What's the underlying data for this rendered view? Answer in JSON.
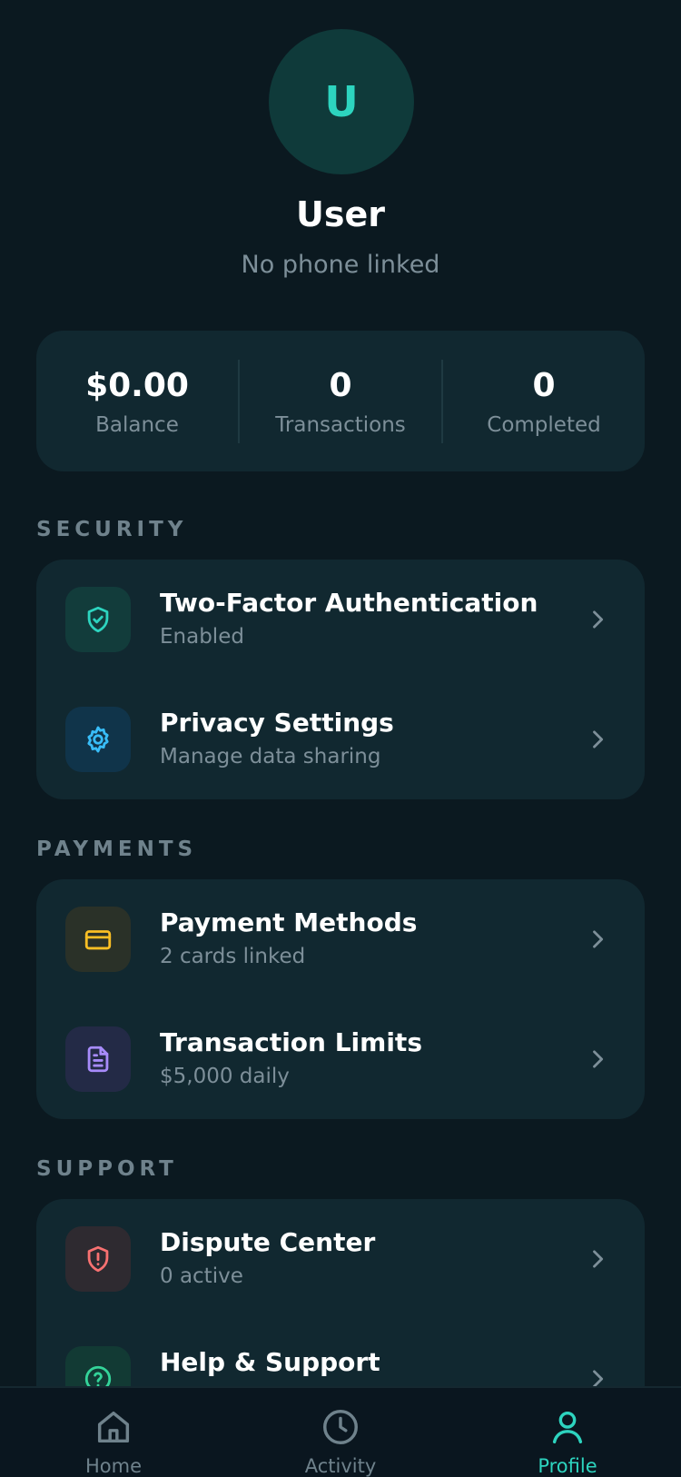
{
  "profile": {
    "avatar_initial": "U",
    "name": "User",
    "phone": "No phone linked"
  },
  "stats": [
    {
      "value": "$0.00",
      "label": "Balance"
    },
    {
      "value": "0",
      "label": "Transactions"
    },
    {
      "value": "0",
      "label": "Completed"
    }
  ],
  "sections": {
    "security": {
      "title": "SECURITY",
      "items": [
        {
          "title": "Two-Factor Authentication",
          "subtitle": "Enabled",
          "icon": "shield-check-icon",
          "color": "#2dd4bf"
        },
        {
          "title": "Privacy Settings",
          "subtitle": "Manage data sharing",
          "icon": "gear-icon",
          "color": "#38bdf8"
        }
      ]
    },
    "payments": {
      "title": "PAYMENTS",
      "items": [
        {
          "title": "Payment Methods",
          "subtitle": "2 cards linked",
          "icon": "credit-card-icon",
          "color": "#fbbf24"
        },
        {
          "title": "Transaction Limits",
          "subtitle": "$5,000 daily",
          "icon": "document-icon",
          "color": "#a78bfa"
        }
      ]
    },
    "support": {
      "title": "SUPPORT",
      "items": [
        {
          "title": "Dispute Center",
          "subtitle": "0 active",
          "icon": "shield-alert-icon",
          "color": "#f87171"
        },
        {
          "title": "Help & Support",
          "subtitle": "",
          "icon": "help-circle-icon",
          "color": "#34d399"
        }
      ]
    }
  },
  "nav": {
    "items": [
      {
        "label": "Home",
        "icon": "home-icon"
      },
      {
        "label": "Activity",
        "icon": "clock-icon"
      },
      {
        "label": "Profile",
        "icon": "user-icon",
        "active": true
      }
    ]
  },
  "colors": {
    "background": "#0b1920",
    "card": "#112830",
    "accent": "#2dd4bf",
    "muted_text": "#7d8f99"
  }
}
